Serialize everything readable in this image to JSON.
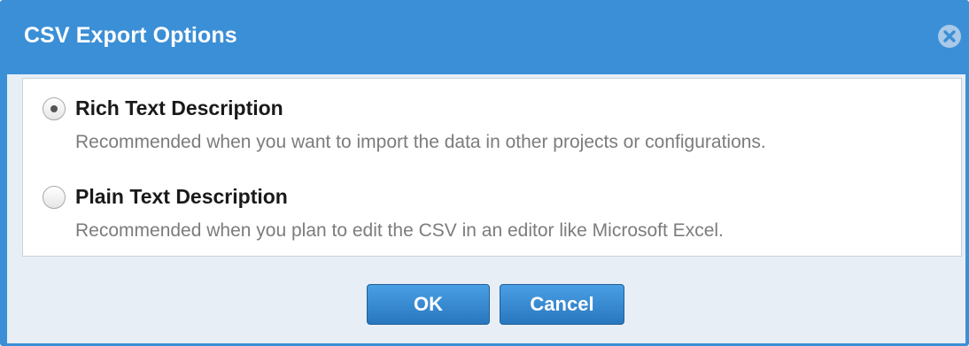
{
  "dialog": {
    "title": "CSV Export Options",
    "close_icon": "close-circle-x-icon"
  },
  "options": [
    {
      "label": "Rich Text Description",
      "description": "Recommended when you want to import the data in other projects or configurations.",
      "selected": true
    },
    {
      "label": "Plain Text Description",
      "description": "Recommended when you plan to edit the CSV in an editor like Microsoft Excel.",
      "selected": false
    }
  ],
  "buttons": {
    "ok_label": "OK",
    "cancel_label": "Cancel"
  },
  "colors": {
    "title_bar": "#3b8fd6",
    "body_background": "#e7eef5",
    "button": "#3a8ad2"
  }
}
